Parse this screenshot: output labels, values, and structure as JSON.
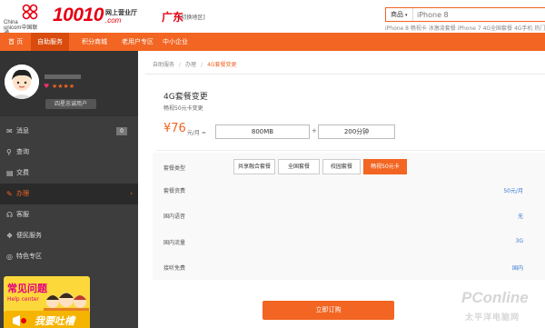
{
  "header": {
    "logo_china": "China",
    "logo_unicom": "unicom中国联通",
    "logo_number": "10010",
    "logo_mall": "网上营业厅",
    "logo_com": ".com",
    "region": "广东",
    "region_switch": "[切换地区]",
    "search_category": "商品",
    "search_placeholder": "iPhone 8",
    "hot_words": "iPhone 8  畅视卡  冰激凌套餐  iPhone 7  4G全国套餐  4G手机  热门手"
  },
  "nav": {
    "items": [
      "首 页",
      "自助服务",
      "积分商城",
      "老用户专区",
      "中小企业"
    ],
    "active_index": 1
  },
  "sidebar": {
    "user_tag": "四星忠诚用户",
    "stars": "★★★★",
    "menu": [
      {
        "icon": "envelope-icon",
        "glyph": "✉",
        "label": "消息",
        "badge": "0"
      },
      {
        "icon": "search-icon",
        "glyph": "⚲",
        "label": "查询"
      },
      {
        "icon": "bill-icon",
        "glyph": "▤",
        "label": "交费"
      },
      {
        "icon": "wrench-icon",
        "glyph": "✎",
        "label": "办理"
      },
      {
        "icon": "headset-icon",
        "glyph": "☊",
        "label": "客服"
      },
      {
        "icon": "gift-icon",
        "glyph": "❖",
        "label": "便民服务"
      },
      {
        "icon": "globe-icon",
        "glyph": "◎",
        "label": "特色专区"
      }
    ],
    "active_index": 3,
    "promo1_title": "常见问题",
    "promo1_sub": "Help center",
    "promo2_title": "我要吐槽"
  },
  "breadcrumb": {
    "items": [
      "自助服务",
      "办理",
      "4G套餐变更"
    ]
  },
  "content": {
    "title": "4G套餐变更",
    "subtitle": "畅视50元卡变更",
    "price": "¥76",
    "price_unit": "元/月 =",
    "plus": "+",
    "option_data": "800MB",
    "option_voice": "200分钟",
    "type_label": "套餐类型",
    "types": [
      "共享融合套餐",
      "全国套餐",
      "校园套餐",
      "畅视50元卡"
    ],
    "active_type": 3,
    "rows": [
      {
        "label": "套餐资费",
        "value": "50元/月"
      },
      {
        "label": "国内语音",
        "value": "无"
      },
      {
        "label": "国内流量",
        "value": "3G"
      },
      {
        "label": "接听免费",
        "value": "国内"
      }
    ],
    "order_button": "立即订购"
  },
  "watermark": {
    "text": "PConline",
    "sub": "太平洋电脑网"
  },
  "colors": {
    "brand": "#f26522",
    "unicom_red": "#e60012",
    "sidebar_bg": "#3d3d3d",
    "link_blue": "#3a7bd5"
  }
}
